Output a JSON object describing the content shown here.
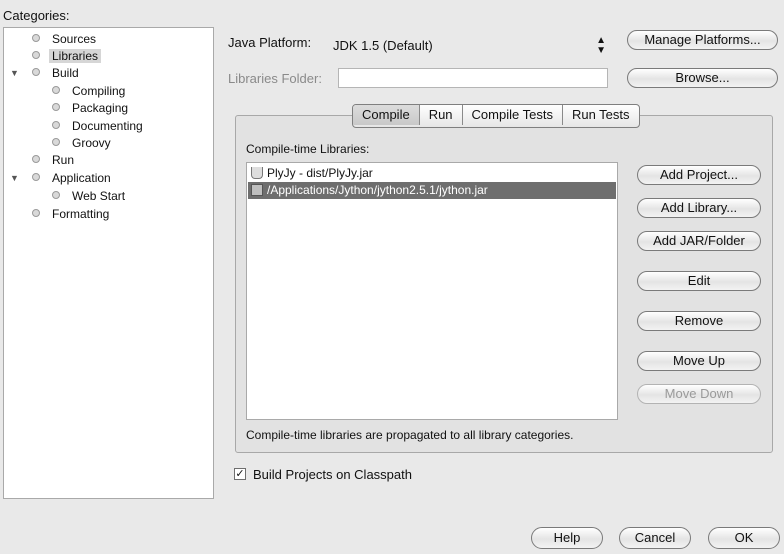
{
  "categories": {
    "label": "Categories:",
    "items": [
      {
        "label": "Sources"
      },
      {
        "label": "Libraries"
      },
      {
        "label": "Build"
      },
      {
        "label": "Compiling"
      },
      {
        "label": "Packaging"
      },
      {
        "label": "Documenting"
      },
      {
        "label": "Groovy"
      },
      {
        "label": "Run"
      },
      {
        "label": "Application"
      },
      {
        "label": "Web Start"
      },
      {
        "label": "Formatting"
      }
    ]
  },
  "platform": {
    "label": "Java Platform:",
    "value": "JDK 1.5 (Default)",
    "manage_button": "Manage Platforms..."
  },
  "libraries_folder": {
    "label": "Libraries Folder:",
    "value": "",
    "browse_button": "Browse..."
  },
  "tabs": [
    {
      "label": "Compile"
    },
    {
      "label": "Run"
    },
    {
      "label": "Compile Tests"
    },
    {
      "label": "Run Tests"
    }
  ],
  "compile": {
    "list_label": "Compile-time Libraries:",
    "libraries": [
      {
        "label": "PlyJy - dist/PlyJy.jar",
        "icon": "project-icon"
      },
      {
        "label": "/Applications/Jython/jython2.5.1/jython.jar",
        "icon": "jar-icon"
      }
    ],
    "buttons": {
      "add_project": "Add Project...",
      "add_library": "Add Library...",
      "add_jar": "Add JAR/Folder",
      "edit": "Edit",
      "remove": "Remove",
      "move_up": "Move Up",
      "move_down": "Move Down"
    },
    "note": "Compile-time libraries are propagated to all library categories."
  },
  "build_on_classpath": {
    "label": "Build Projects on Classpath",
    "checked": true,
    "check_glyph": "✓"
  },
  "dialog_buttons": {
    "help": "Help",
    "cancel": "Cancel",
    "ok": "OK"
  }
}
